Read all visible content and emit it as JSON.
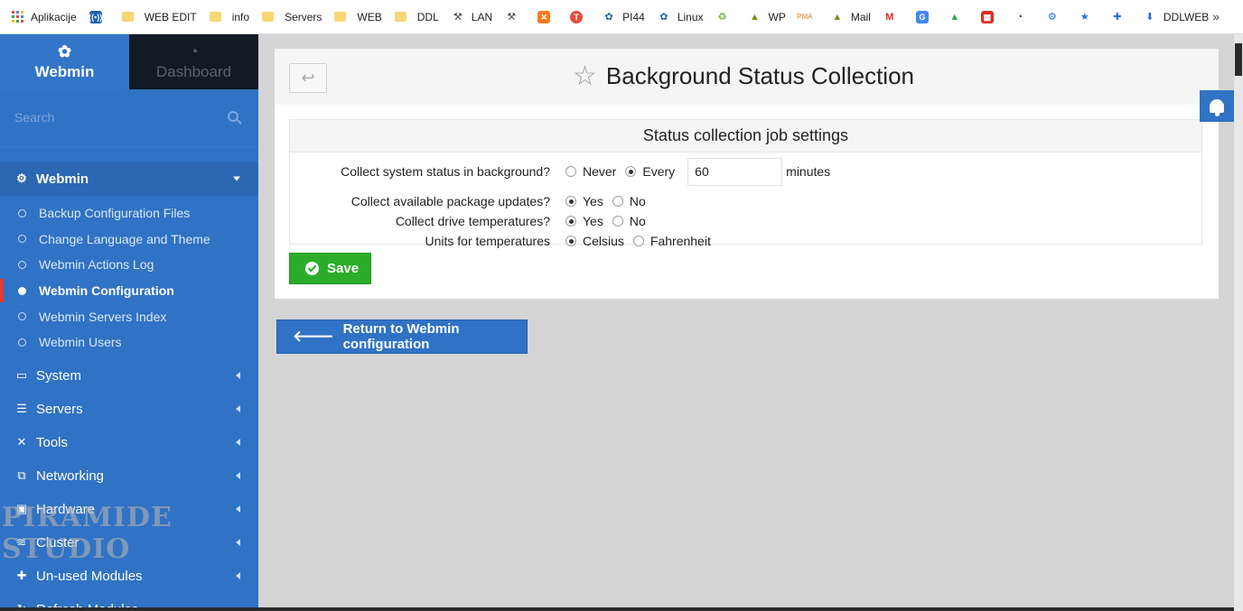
{
  "bookmarks": [
    {
      "label": "Aplikacije",
      "icon": "apps-grid-icon"
    },
    {
      "label": "",
      "icon": "radio-icon"
    },
    {
      "label": "WEB EDIT",
      "icon": "folder-icon"
    },
    {
      "label": "info",
      "icon": "folder-icon"
    },
    {
      "label": "Servers",
      "icon": "folder-icon"
    },
    {
      "label": "WEB",
      "icon": "folder-icon"
    },
    {
      "label": "DDL",
      "icon": "folder-icon"
    },
    {
      "label": "LAN",
      "icon": "lan-icon"
    },
    {
      "label": "",
      "icon": "lan2-icon"
    },
    {
      "label": "",
      "icon": "xampp-icon"
    },
    {
      "label": "",
      "icon": "turris-icon"
    },
    {
      "label": "PI44",
      "icon": "webmin-icon"
    },
    {
      "label": "Linux",
      "icon": "webmin-icon"
    },
    {
      "label": "",
      "icon": "recycle-icon"
    },
    {
      "label": "WP",
      "icon": "triangle-icon"
    },
    {
      "label": "",
      "icon": "pma-icon"
    },
    {
      "label": "Mail",
      "icon": "triangle-icon"
    },
    {
      "label": "",
      "icon": "gmail-icon"
    },
    {
      "label": "",
      "icon": "translate-icon"
    },
    {
      "label": "",
      "icon": "drive-icon"
    },
    {
      "label": "",
      "icon": "calendar-icon"
    },
    {
      "label": "",
      "icon": "speedometer-icon"
    },
    {
      "label": "",
      "icon": "gear-icon"
    },
    {
      "label": "",
      "icon": "star-icon"
    },
    {
      "label": "",
      "icon": "puzzle-icon"
    },
    {
      "label": "DDLWEB",
      "icon": "download-icon"
    }
  ],
  "bookmarks_more": "»",
  "sidebar": {
    "tabs": [
      {
        "label": "Webmin",
        "icon": "webmin-logo-icon"
      },
      {
        "label": "Dashboard",
        "icon": "dashboard-icon"
      }
    ],
    "search_placeholder": "Search",
    "open_category": "Webmin",
    "sub_items": [
      "Backup Configuration Files",
      "Change Language and Theme",
      "Webmin Actions Log",
      "Webmin Configuration",
      "Webmin Servers Index",
      "Webmin Users"
    ],
    "active_sub_item": "Webmin Configuration",
    "categories": [
      {
        "label": "System",
        "icon": "laptop-icon"
      },
      {
        "label": "Servers",
        "icon": "server-icon"
      },
      {
        "label": "Tools",
        "icon": "tools-icon"
      },
      {
        "label": "Networking",
        "icon": "network-icon"
      },
      {
        "label": "Hardware",
        "icon": "hardware-icon"
      },
      {
        "label": "Cluster",
        "icon": "cluster-icon"
      },
      {
        "label": "Un-used Modules",
        "icon": "puzzle-icon"
      },
      {
        "label": "Refresh Modules",
        "icon": "refresh-icon"
      }
    ],
    "watermark": "PIRAMIDE STUDIO"
  },
  "page": {
    "title": "Background Status Collection",
    "section_title": "Status collection job settings",
    "rows": [
      {
        "label": "Collect system status in background?",
        "options": [
          "Never",
          "Every"
        ],
        "selected": "Every",
        "input_value": "60",
        "unit": "minutes"
      },
      {
        "label": "Collect available package updates?",
        "options": [
          "Yes",
          "No"
        ],
        "selected": "Yes"
      },
      {
        "label": "Collect drive temperatures?",
        "options": [
          "Yes",
          "No"
        ],
        "selected": "Yes"
      },
      {
        "label": "Units for temperatures",
        "options": [
          "Celsius",
          "Fahrenheit"
        ],
        "selected": "Celsius"
      }
    ],
    "save_label": "Save",
    "return_label": "Return to Webmin configuration"
  },
  "colors": {
    "sidebar": "#3072c4",
    "save": "#2bad2b",
    "accent_active": "#e53935"
  }
}
